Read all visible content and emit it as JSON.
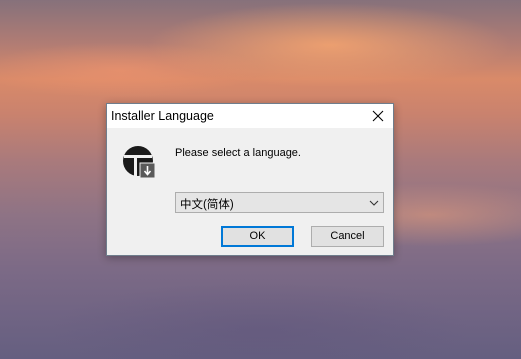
{
  "dialog": {
    "title": "Installer Language",
    "prompt": "Please select a language.",
    "language_select": {
      "selected": "中文(简体)"
    },
    "ok_label": "OK",
    "cancel_label": "Cancel"
  },
  "icons": {
    "close": "close-icon",
    "app": "installer-app-icon",
    "dropdown": "chevron-down-icon"
  },
  "colors": {
    "focus_accent": "#0078d7",
    "dialog_bg": "#f0f0f0"
  }
}
